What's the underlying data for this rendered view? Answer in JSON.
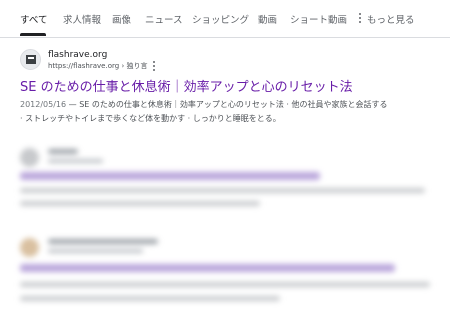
{
  "tabs": [
    "すべて",
    "求人情報",
    "画像",
    "ニュース",
    "ショッピング",
    "動画",
    "ショート動画",
    "もっと見る"
  ],
  "result": {
    "site_name": "flashrave.org",
    "url": "https://flashrave.org",
    "breadcrumb": "› 独り言",
    "title": "SE のための仕事と休息術｜効率アップと心のリセット法",
    "date": "2012/05/16",
    "snippet_1": " — SE のための仕事と休息術｜効率アップと心のリセット法 · 他の社員や家族と会話する",
    "snippet_2": "· ストレッチやトイレまで歩くなど体を動かす · しっかりと睡眠をとる。"
  },
  "colors": {
    "link": "#681da8",
    "text": "#4d5156",
    "active_tab": "#202124"
  }
}
